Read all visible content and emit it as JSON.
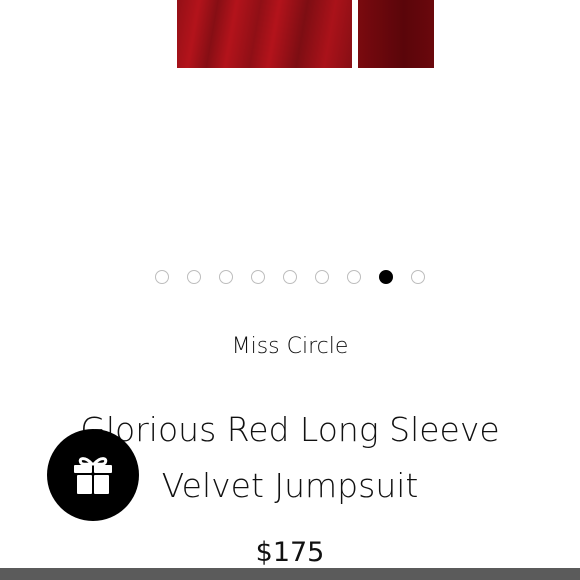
{
  "product": {
    "image": {
      "alt": "Red velvet jumpsuit photo",
      "colors": {
        "velvet_red": "#b3131b",
        "shadow_red": "#5a050a"
      }
    },
    "carousel": {
      "total": 9,
      "active_index": 7
    },
    "brand": "Miss Circle",
    "title": "Glorious Red Long Sleeve Velvet Jumpsuit",
    "price": "$175"
  },
  "floating": {
    "gift_icon": "gift-icon"
  },
  "colors": {
    "active_dot": "#000000",
    "inactive_dot_border": "#bdbdbd",
    "gift_button_bg": "#000000",
    "bottom_bar": "#5b5b5b"
  }
}
